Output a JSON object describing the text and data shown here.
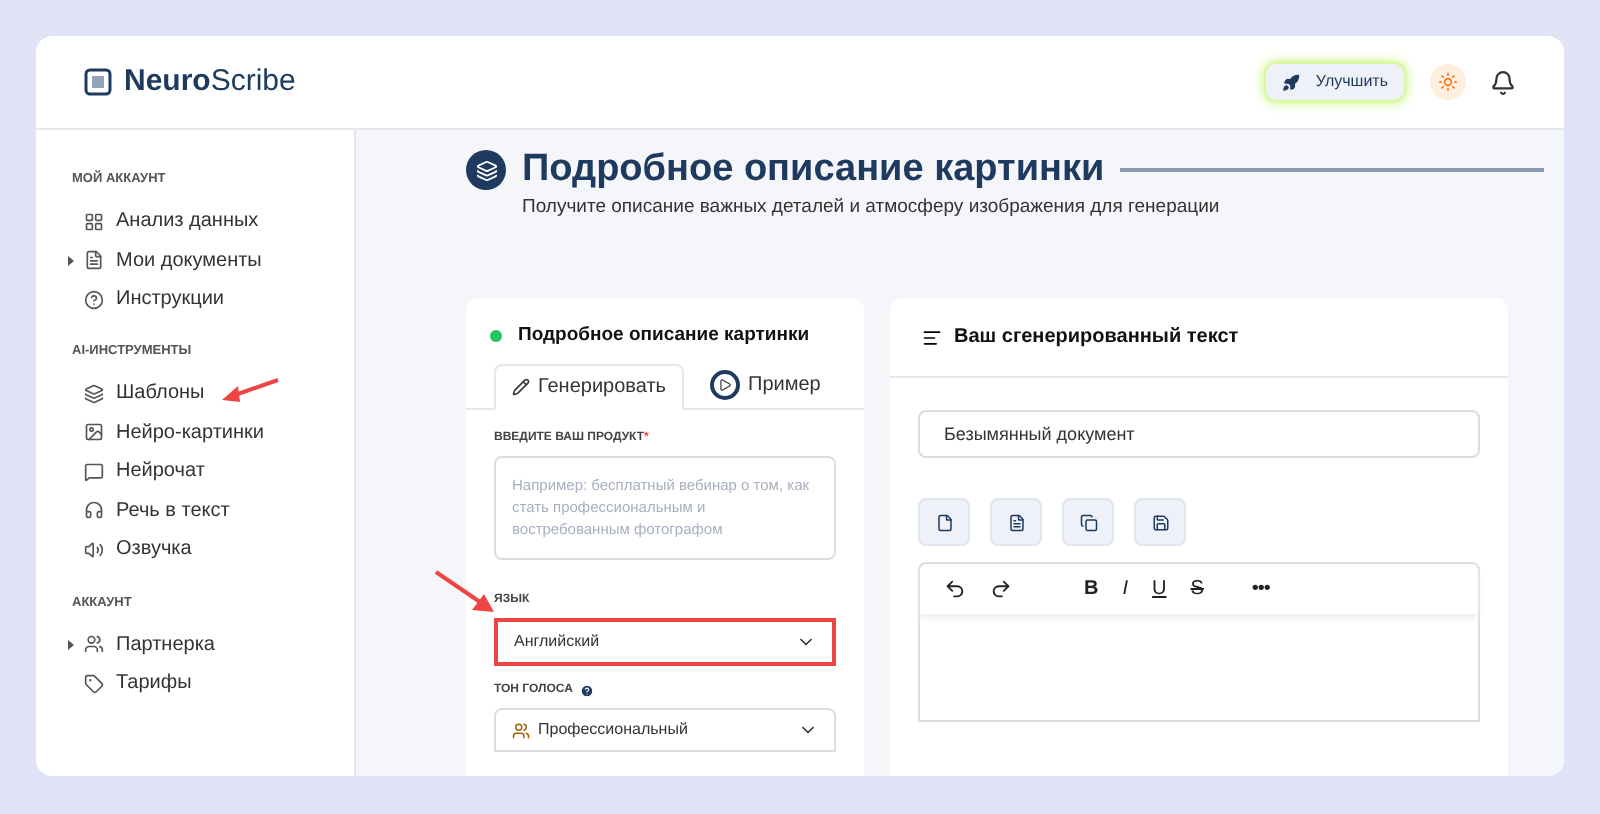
{
  "brand": {
    "name_bold": "Neuro",
    "name_light": "Scribe"
  },
  "header": {
    "upgrade_button": "Улучшить"
  },
  "sidebar": {
    "sections": [
      {
        "title": "МОЙ АККАУНТ",
        "items": [
          {
            "label": "Анализ данных",
            "expandable": false
          },
          {
            "label": "Мои документы",
            "expandable": true
          },
          {
            "label": "Инструкции",
            "expandable": false
          }
        ]
      },
      {
        "title": "AI-ИНСТРУМЕНТЫ",
        "items": [
          {
            "label": "Шаблоны",
            "expandable": false
          },
          {
            "label": "Нейро-картинки",
            "expandable": false
          },
          {
            "label": "Нейрочат",
            "expandable": false
          },
          {
            "label": "Речь в текст",
            "expandable": false
          },
          {
            "label": "Озвучка",
            "expandable": false
          }
        ]
      },
      {
        "title": "АККАУНТ",
        "items": [
          {
            "label": "Партнерка",
            "expandable": true
          },
          {
            "label": "Тарифы",
            "expandable": false
          }
        ]
      }
    ]
  },
  "page": {
    "title": "Подробное описание картинки",
    "subtitle": "Получите описание важных деталей и атмосферу изображения для генерации"
  },
  "form_card": {
    "title": "Подробное описание картинки",
    "tabs": [
      {
        "label": "Генерировать",
        "selected": true
      },
      {
        "label": "Пример",
        "selected": false
      }
    ],
    "product_label": "ВВЕДИТЕ ВАШ ПРОДУКТ",
    "product_required": "*",
    "product_placeholder": "Например: бесплатный вебинар о том, как стать профессиональным и востребованным фотографом",
    "language_label": "ЯЗЫК",
    "language_value": "Английский",
    "language_highlighted": true,
    "tone_label": "ТОН ГОЛОСА",
    "tone_value": "Профессиональный"
  },
  "output_card": {
    "title": "Ваш сгенерированный текст",
    "document_name": "Безымянный документ",
    "format_buttons": [
      "B",
      "I",
      "U",
      "S",
      "•••"
    ]
  }
}
